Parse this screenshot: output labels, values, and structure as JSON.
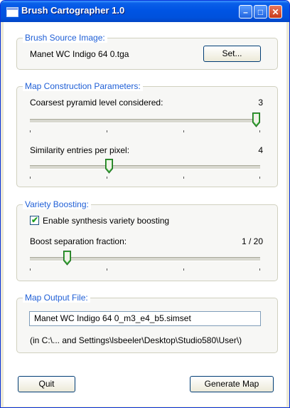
{
  "window": {
    "title": "Brush Cartographer 1.0",
    "min_glyph": "–",
    "max_glyph": "□",
    "close_glyph": "✕"
  },
  "brush_source": {
    "title": "Brush Source Image:",
    "filename": "Manet WC Indigo 64 0.tga",
    "set_label": "Set..."
  },
  "map_params": {
    "title": "Map Construction Parameters:",
    "coarsest_label": "Coarsest pyramid level considered:",
    "coarsest_value": "3",
    "coarsest_position": 1.0,
    "similarity_label": "Similarity entries per pixel:",
    "similarity_value": "4",
    "similarity_position": 0.34
  },
  "variety": {
    "title": "Variety Boosting:",
    "checkbox_label": "Enable synthesis variety boosting",
    "checkbox_checked": true,
    "boost_label": "Boost separation fraction:",
    "boost_value": "1 / 20",
    "boost_position": 0.15
  },
  "output": {
    "title": "Map Output File:",
    "filename": "Manet WC Indigo 64 0_m3_e4_b5.simset",
    "path": "(in C:\\... and Settings\\lsbeeler\\Desktop\\Studio580\\User\\)"
  },
  "footer": {
    "quit_label": "Quit",
    "generate_label": "Generate Map"
  },
  "colors": {
    "title_bar": "#0054e3",
    "group_title": "#1f5fd6",
    "thumb_green": "#3fb23f"
  }
}
